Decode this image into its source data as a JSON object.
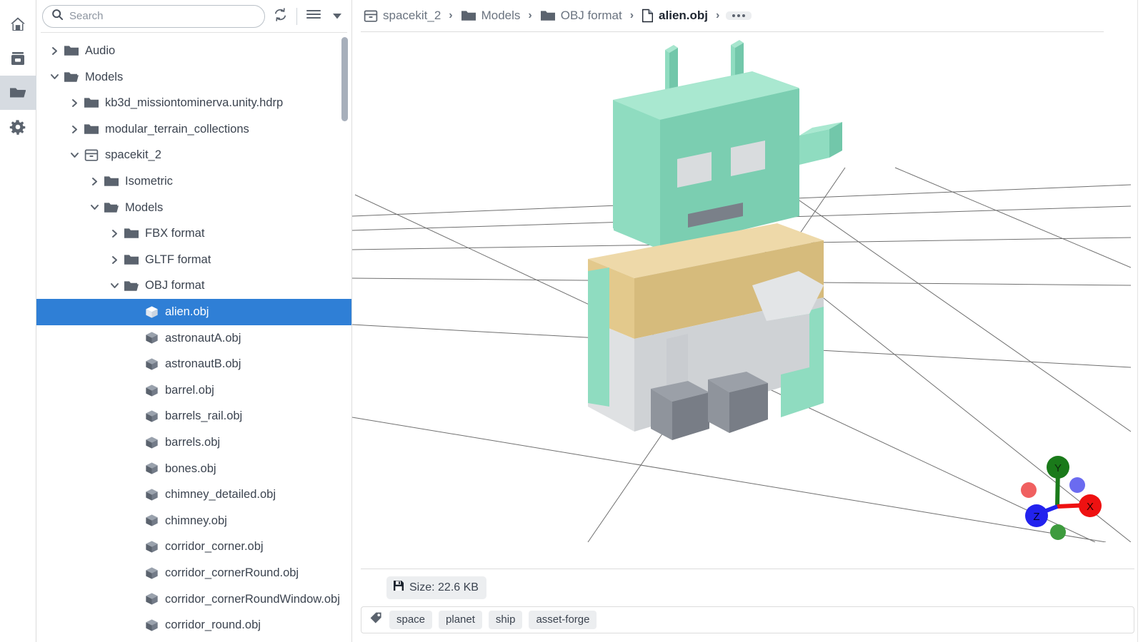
{
  "rail": {
    "items": [
      {
        "name": "home",
        "icon": "home-icon",
        "active": false
      },
      {
        "name": "archive",
        "icon": "archive-icon",
        "active": false
      },
      {
        "name": "files",
        "icon": "folder-icon",
        "active": true
      },
      {
        "name": "settings",
        "icon": "gear-icon",
        "active": false
      }
    ]
  },
  "sidebar": {
    "search": {
      "value": "",
      "placeholder": "Search"
    },
    "toolbar": {
      "refresh_icon": "refresh-icon",
      "menu_icon": "hamburger-menu-icon",
      "caret_icon": "chevron-down-icon"
    },
    "tree": [
      {
        "label": "Audio",
        "indent": 0,
        "icon": "folder-closed-icon",
        "chev": "right",
        "selected": false
      },
      {
        "label": "Models",
        "indent": 0,
        "icon": "folder-open-icon",
        "chev": "down",
        "selected": false
      },
      {
        "label": "kb3d_missiontominerva.unity.hdrp",
        "indent": 1,
        "icon": "folder-closed-icon",
        "chev": "right",
        "selected": false
      },
      {
        "label": "modular_terrain_collections",
        "indent": 1,
        "icon": "folder-closed-icon",
        "chev": "right",
        "selected": false
      },
      {
        "label": "spacekit_2",
        "indent": 1,
        "icon": "package-icon",
        "chev": "down",
        "selected": false
      },
      {
        "label": "Isometric",
        "indent": 2,
        "icon": "folder-closed-icon",
        "chev": "right",
        "selected": false
      },
      {
        "label": "Models",
        "indent": 2,
        "icon": "folder-open-icon",
        "chev": "down",
        "selected": false
      },
      {
        "label": "FBX format",
        "indent": 3,
        "icon": "folder-closed-icon",
        "chev": "right",
        "selected": false
      },
      {
        "label": "GLTF format",
        "indent": 3,
        "icon": "folder-closed-icon",
        "chev": "right",
        "selected": false
      },
      {
        "label": "OBJ format",
        "indent": 3,
        "icon": "folder-open-icon",
        "chev": "down",
        "selected": false
      },
      {
        "label": "alien.obj",
        "indent": 4,
        "icon": "model-cube-icon",
        "chev": "none",
        "selected": true
      },
      {
        "label": "astronautA.obj",
        "indent": 4,
        "icon": "model-cube-icon",
        "chev": "none",
        "selected": false
      },
      {
        "label": "astronautB.obj",
        "indent": 4,
        "icon": "model-cube-icon",
        "chev": "none",
        "selected": false
      },
      {
        "label": "barrel.obj",
        "indent": 4,
        "icon": "model-cube-icon",
        "chev": "none",
        "selected": false
      },
      {
        "label": "barrels_rail.obj",
        "indent": 4,
        "icon": "model-cube-icon",
        "chev": "none",
        "selected": false
      },
      {
        "label": "barrels.obj",
        "indent": 4,
        "icon": "model-cube-icon",
        "chev": "none",
        "selected": false
      },
      {
        "label": "bones.obj",
        "indent": 4,
        "icon": "model-cube-icon",
        "chev": "none",
        "selected": false
      },
      {
        "label": "chimney_detailed.obj",
        "indent": 4,
        "icon": "model-cube-icon",
        "chev": "none",
        "selected": false
      },
      {
        "label": "chimney.obj",
        "indent": 4,
        "icon": "model-cube-icon",
        "chev": "none",
        "selected": false
      },
      {
        "label": "corridor_corner.obj",
        "indent": 4,
        "icon": "model-cube-icon",
        "chev": "none",
        "selected": false
      },
      {
        "label": "corridor_cornerRound.obj",
        "indent": 4,
        "icon": "model-cube-icon",
        "chev": "none",
        "selected": false
      },
      {
        "label": "corridor_cornerRoundWindow.obj",
        "indent": 4,
        "icon": "model-cube-icon",
        "chev": "none",
        "selected": false
      },
      {
        "label": "corridor_round.obj",
        "indent": 4,
        "icon": "model-cube-icon",
        "chev": "none",
        "selected": false
      }
    ]
  },
  "main": {
    "breadcrumb": [
      {
        "label": "spacekit_2",
        "icon": "package-icon",
        "current": false
      },
      {
        "label": "Models",
        "icon": "folder-closed-icon",
        "current": false
      },
      {
        "label": "OBJ format",
        "icon": "folder-closed-icon",
        "current": false
      },
      {
        "label": "alien.obj",
        "icon": "file-icon",
        "current": true
      }
    ],
    "breadcrumb_separator": "›",
    "breadcrumb_more": "…",
    "size_badge": {
      "icon": "save-disk-icon",
      "label": "Size: 22.6 KB"
    },
    "tags": {
      "icon": "tag-icon",
      "items": [
        "space",
        "planet",
        "ship",
        "asset-forge"
      ]
    },
    "gizmo": {
      "axes": [
        {
          "label": "X",
          "color": "#ee1111"
        },
        {
          "label": "Y",
          "color": "#1a7a1a"
        },
        {
          "label": "Z",
          "color": "#2222ee"
        }
      ],
      "negative_dots": [
        {
          "color": "#f06060"
        },
        {
          "color": "#6b6bf0"
        },
        {
          "color": "#3d9b3d"
        }
      ]
    },
    "model": {
      "name": "alien",
      "colors": {
        "skin": "#8fdcc0",
        "skin_light": "#a7e6ce",
        "skin_dark": "#72c7aa",
        "belt": "#e3c98c",
        "belt_dark": "#cfb276",
        "suit": "#dfe1e3",
        "suit_dark": "#c3c6ca",
        "boot": "#8f949c",
        "boot_dark": "#757a82",
        "eye": "#d9dcde",
        "mouth": "#7a8089"
      }
    }
  },
  "colors": {
    "accent": "#2f7fd6",
    "text": "#3c4450",
    "muted": "#6b7480",
    "border": "#dcdcdc",
    "chip": "#eceef0",
    "rail_active": "#d6dbe1"
  }
}
